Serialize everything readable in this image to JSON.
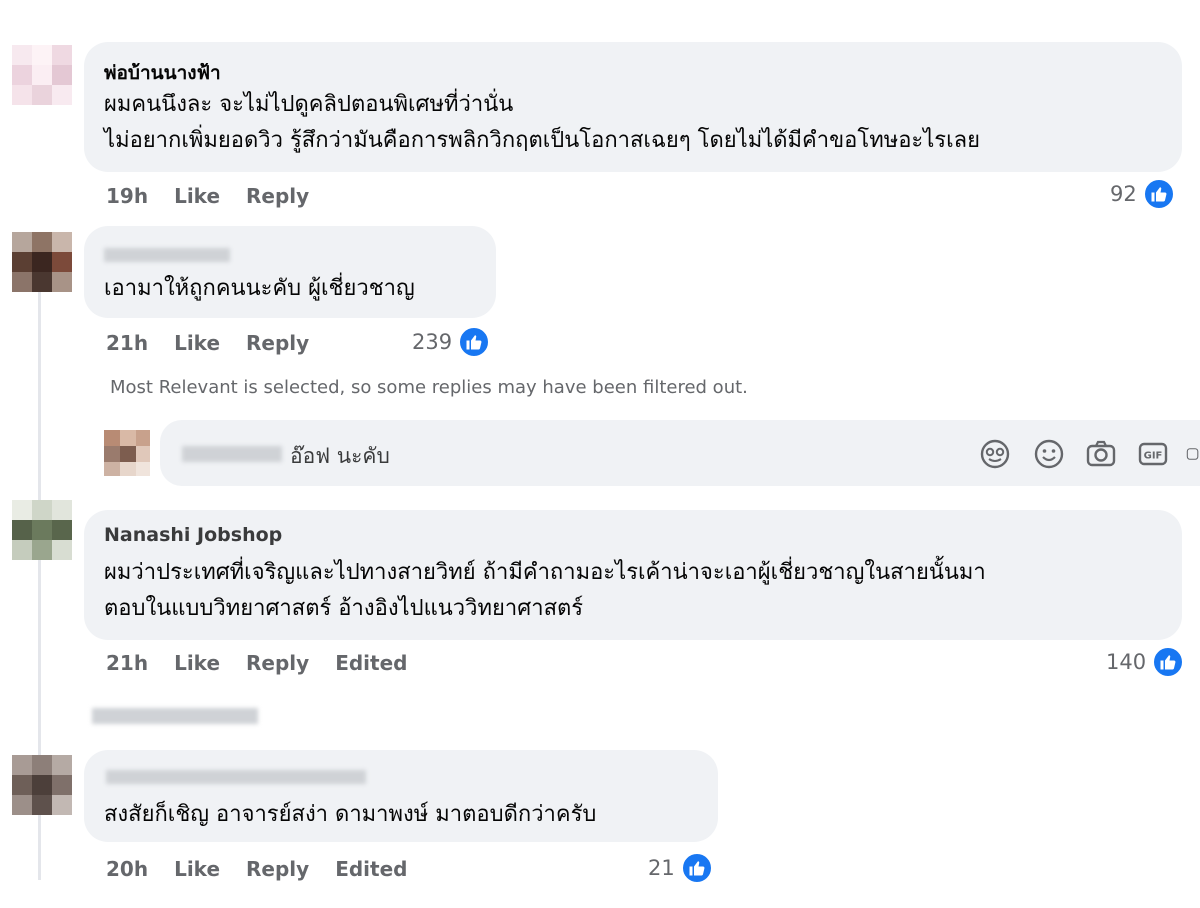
{
  "comments": [
    {
      "author": "พ่อบ้านนางฟ้า",
      "lines": [
        "ผมคนนึงละ จะไม่ไปดูคลิปตอนพิเศษที่ว่านั่น",
        "ไม่อยากเพิ่มยอดวิว รู้สึกว่ามันคือการพลิกวิกฤตเป็นโอกาสเฉยๆ โดยไม่ได้มีคำขอโทษอะไรเลย"
      ],
      "time": "19h",
      "like_label": "Like",
      "reply_label": "Reply",
      "likes": "92"
    },
    {
      "author": "",
      "lines": [
        "เอามาให้ถูกคนนะคับ ผู้เชี่ยวชาญ"
      ],
      "time": "21h",
      "like_label": "Like",
      "reply_label": "Reply",
      "likes": "239"
    },
    {
      "author": "Nanashi Jobshop",
      "lines": [
        "ผมว่าประเทศที่เจริญและไปทางสายวิทย์ ถ้ามีคำถามอะไรเค้าน่าจะเอาผู้เชี่ยวชาญในสายนั้นมา",
        "ตอบในแบบวิทยาศาสตร์ อ้างอิงไปแนววิทยาศาสตร์"
      ],
      "time": "21h",
      "like_label": "Like",
      "reply_label": "Reply",
      "edited_label": "Edited",
      "likes": "140"
    },
    {
      "author": "",
      "lines": [
        "สงสัยก็เชิญ อาจารย์สง่า ดามาพงษ์ มาตอบดีกว่าครับ"
      ],
      "time": "20h",
      "like_label": "Like",
      "reply_label": "Reply",
      "edited_label": "Edited",
      "likes": "21"
    }
  ],
  "filter_note": "Most Relevant is selected, so some replies may have been filtered out.",
  "composer": {
    "text": "อ๊อฟ นะคับ",
    "icons": [
      "sticker-icon",
      "emoji-icon",
      "camera-icon",
      "gif-icon"
    ]
  },
  "colors": {
    "like_blue": "#1877f2",
    "bubble": "#f0f2f5",
    "meta_gray": "#65676b"
  }
}
